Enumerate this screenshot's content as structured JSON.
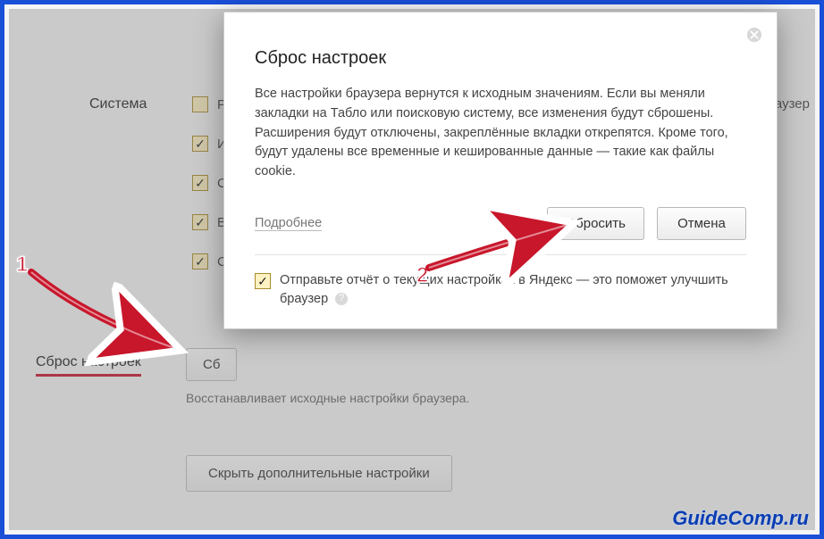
{
  "bg": {
    "system_label": "Система",
    "cb0_text": "Р",
    "cb1_text": "И",
    "cb2_text": "С",
    "cb3_text": "В",
    "cb4_text": "С",
    "reset_section_label": "Сброс настроек",
    "reset_button_frag": "Сб",
    "reset_desc": "Восстанавливает исходные настройки браузера.",
    "hide_adv_button": "Скрыть дополнительные настройки",
    "right_edge_frag": "раузер"
  },
  "modal": {
    "title": "Сброс настроек",
    "body": "Все настройки браузера вернутся к исходным значениям. Если вы меняли закладки на Табло или поисковую систему, все изменения будут сброшены. Расширения будут отключены, закреплённые вкладки открепятся. Кроме того, будут удалены все временные и кешированные данные — такие как файлы cookie.",
    "more_link": "Подробнее",
    "confirm_button": "Сбросить",
    "cancel_button": "Отмена",
    "report_text": "Отправьте отчёт о текущих настройках в Яндекс — это поможет улучшить браузер",
    "report_checked": true
  },
  "annotations": {
    "num1": "1",
    "num2": "2"
  },
  "watermark": "GuideComp.ru"
}
